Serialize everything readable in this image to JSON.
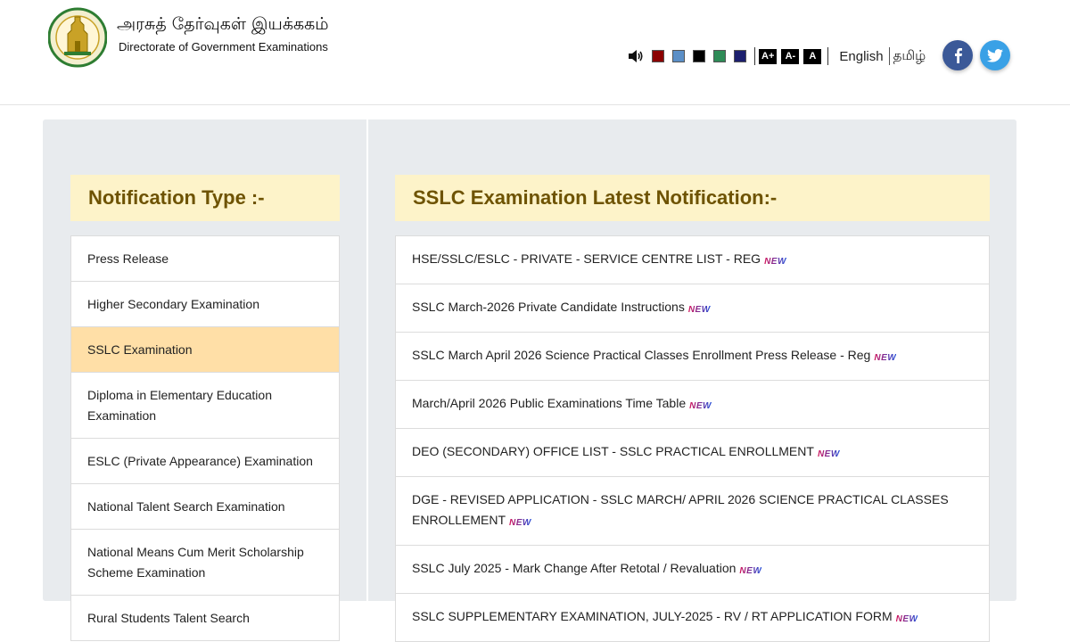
{
  "header": {
    "title_tamil": "அரசுத் தேர்வுகள் இயக்ககம்",
    "title_english": "Directorate of Government Examinations",
    "logo_icon": "tamil-nadu-emblem-icon"
  },
  "toolbar": {
    "speaker_icon": "speaker-icon",
    "theme_colors": [
      "#8b0000",
      "#5b8fc7",
      "#000000",
      "#2e8b57",
      "#1c1f6e"
    ],
    "font_increase_label": "A+",
    "font_decrease_label": "A-",
    "font_reset_label": "A",
    "lang_english": "English",
    "lang_tamil": "தமிழ்",
    "facebook_icon": "facebook-icon",
    "twitter_icon": "twitter-icon"
  },
  "sidebar": {
    "heading": "Notification Type :-",
    "items": [
      {
        "label": "Press Release"
      },
      {
        "label": "Higher Secondary Examination"
      },
      {
        "label": "SSLC Examination",
        "active": true
      },
      {
        "label": "Diploma in Elementary Education Examination"
      },
      {
        "label": "ESLC (Private Appearance) Examination"
      },
      {
        "label": "National Talent Search Examination"
      },
      {
        "label": "National Means Cum Merit Scholarship Scheme Examination"
      },
      {
        "label": "Rural Students Talent Search"
      }
    ]
  },
  "main": {
    "heading": "SSLC Examination Latest Notification:-",
    "new_label": "NEW",
    "notifications": [
      {
        "text": "HSE/SSLC/ESLC - PRIVATE - SERVICE CENTRE LIST - REG"
      },
      {
        "text": "SSLC March-2026 Private Candidate Instructions"
      },
      {
        "text": "SSLC March April 2026 Science Practical Classes Enrollment Press Release - Reg"
      },
      {
        "text": "March/April 2026 Public Examinations Time Table"
      },
      {
        "text": "DEO (SECONDARY) OFFICE LIST - SSLC PRACTICAL ENROLLMENT"
      },
      {
        "text": "DGE - REVISED APPLICATION - SSLC MARCH/ APRIL 2026 SCIENCE PRACTICAL CLASSES ENROLLEMENT"
      },
      {
        "text": "SSLC July 2025 - Mark Change After Retotal / Revaluation"
      },
      {
        "text": "SSLC SUPPLEMENTARY EXAMINATION, JULY-2025 - RV / RT APPLICATION FORM"
      }
    ]
  }
}
